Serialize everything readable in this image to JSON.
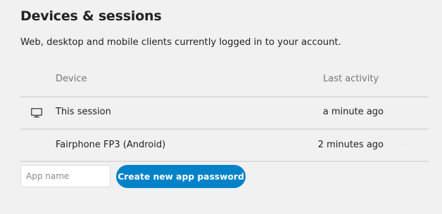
{
  "section": {
    "title": "Devices & sessions",
    "description": "Web, desktop and mobile clients currently logged in to your account."
  },
  "table": {
    "headers": {
      "device": "Device",
      "last_activity": "Last activity"
    },
    "rows": [
      {
        "icon": "monitor-icon",
        "device": "This session",
        "last_activity": "a minute ago"
      },
      {
        "icon": "",
        "device": "Fairphone FP3 (Android)",
        "last_activity": "2 minutes ago",
        "action_icon": "more-icon"
      }
    ]
  },
  "app_password": {
    "input_placeholder": "App name",
    "input_value": "",
    "button_label": "Create new app password"
  },
  "colors": {
    "background": "#f1f1f1",
    "text": "#222222",
    "muted_text": "#767676",
    "divider": "#dcdcdc",
    "primary": "#0082c9"
  }
}
